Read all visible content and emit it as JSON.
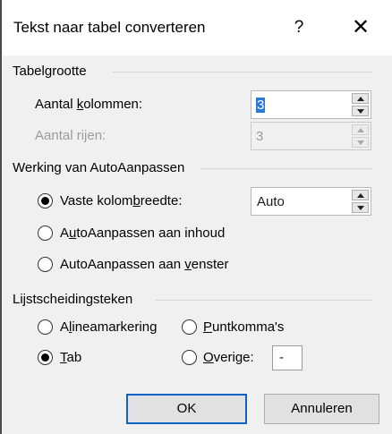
{
  "title": "Tekst naar tabel converteren",
  "help_label": "?",
  "close_label": "✕",
  "tabelgrootte": {
    "group_label": "Tabelgrootte",
    "kolommen_pre": "Aantal ",
    "kolommen_ul": "k",
    "kolommen_post": "olommen:",
    "kolommen_value": "3",
    "rijen_label": "Aantal rijen:",
    "rijen_value": "3"
  },
  "autoaanpassen": {
    "group_label": "Werking van AutoAanpassen",
    "vaste_pre": "Vaste kolom",
    "vaste_ul": "b",
    "vaste_post": "reedte:",
    "vaste_value": "Auto",
    "inhoud_pre": "A",
    "inhoud_ul": "u",
    "inhoud_post": "toAanpassen aan inhoud",
    "venster_pre": "AutoAanpassen aan ",
    "venster_ul": "v",
    "venster_post": "enster",
    "selected": "vaste"
  },
  "lijst": {
    "group_label": "Lijstscheidingsteken",
    "alinea_pre": "A",
    "alinea_ul": "l",
    "alinea_post": "ineamarkering",
    "punt_ul": "P",
    "punt_post": "untkomma's",
    "tab_ul": "T",
    "tab_post": "ab",
    "overige_ul": "O",
    "overige_post": "verige:",
    "overige_value": "-",
    "selected": "tab"
  },
  "buttons": {
    "ok": "OK",
    "cancel": "Annuleren"
  },
  "colors": {
    "default_button_border": "#0a64c8",
    "selection_highlight": "#2b7bd6"
  }
}
